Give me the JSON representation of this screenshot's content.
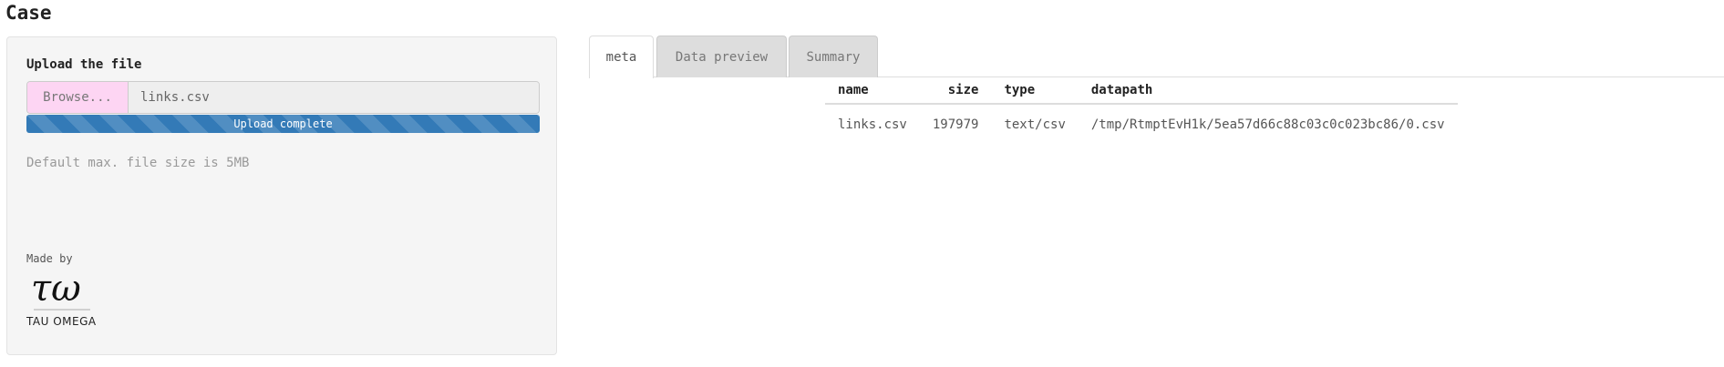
{
  "page": {
    "title": "Case"
  },
  "sidebar": {
    "upload_label": "Upload the file",
    "browse_label": "Browse...",
    "file_name": "links.csv",
    "progress": {
      "label": "Upload complete",
      "percent": 100
    },
    "helper_text": "Default max. file size is 5MB",
    "made_by": "Made by",
    "logo_glyph": "τω",
    "logo_text": "TAU OMEGA"
  },
  "tabs": [
    {
      "label": "meta",
      "active": true
    },
    {
      "label": "Data preview",
      "active": false
    },
    {
      "label": "Summary",
      "active": false
    }
  ],
  "meta_table": {
    "headers": [
      "name",
      "size",
      "type",
      "datapath"
    ],
    "rows": [
      [
        "links.csv",
        "197979",
        "text/csv",
        "/tmp/RtmptEvH1k/5ea57d66c88c03c0c023bc86/0.csv"
      ]
    ]
  },
  "colors": {
    "progress_bar": "#337ab7",
    "browse_button": "#fdd5f3",
    "sidebar_bg": "#f5f5f5"
  }
}
